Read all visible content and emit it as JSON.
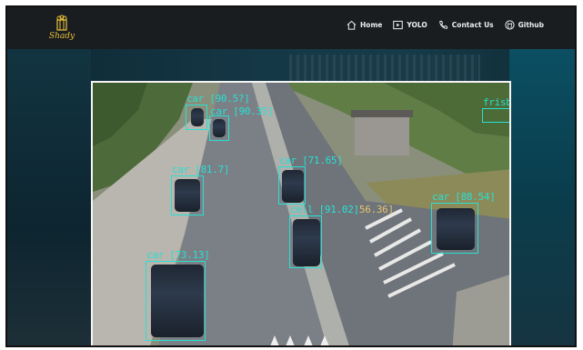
{
  "header": {
    "brand": "Shady",
    "nav": [
      {
        "label": "Home",
        "icon": "home-icon"
      },
      {
        "label": "YOLO",
        "icon": "play-icon"
      },
      {
        "label": "Contact Us",
        "icon": "phone-icon"
      },
      {
        "label": "Github",
        "icon": "github-icon"
      }
    ]
  },
  "detections": [
    {
      "label": "car [90.5?]",
      "second": "car [90.35]"
    },
    {
      "label": "car [81.7]"
    },
    {
      "label": "car [71.65]"
    },
    {
      "label": "cell [91.02]",
      "extra": "56.36]"
    },
    {
      "label": "car [88.54]"
    },
    {
      "label": "car [73.13]"
    },
    {
      "label": "frisbe"
    }
  ],
  "colors": {
    "box": "#27e0d3",
    "brand": "#e9c23a",
    "navbar": "#1a1d20"
  }
}
